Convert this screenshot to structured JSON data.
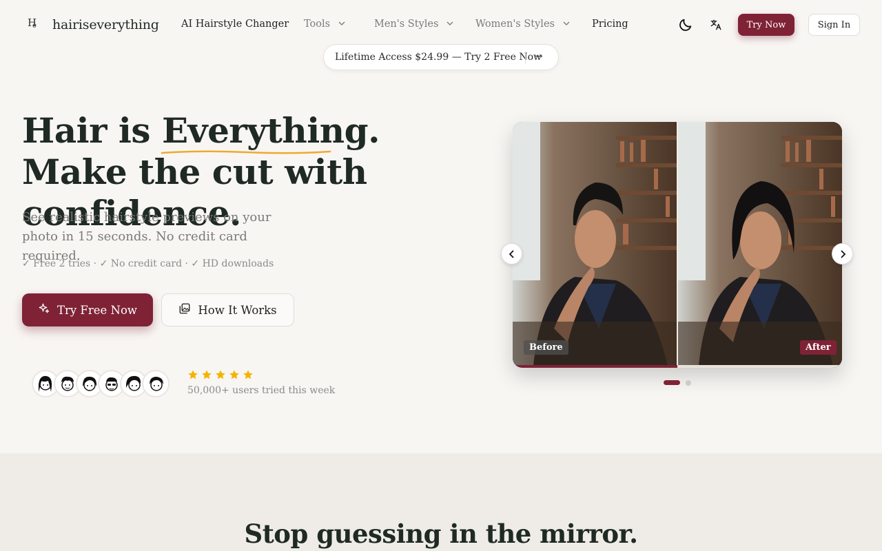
{
  "nav": {
    "brand": "hairiseverything",
    "logo_mark_h": "H",
    "logo_mark_e": "e",
    "items": [
      {
        "label": "AI Hairstyle Changer",
        "has_dropdown": false
      },
      {
        "label": "Tools",
        "has_dropdown": true
      },
      {
        "label": "Men's Styles",
        "has_dropdown": true
      },
      {
        "label": "Women's Styles",
        "has_dropdown": true
      },
      {
        "label": "Pricing",
        "has_dropdown": false
      }
    ],
    "icons": [
      "moon-icon",
      "translate-icon"
    ],
    "try_now_label": "Try Now",
    "sign_in_label": "Sign In"
  },
  "promo": {
    "text": "Lifetime Access $24.99 — Try 2 Free Now",
    "arrow": "→"
  },
  "hero": {
    "title_pre": "Hair is ",
    "title_highlight": "Everything",
    "title_post": ". Make the cut with confidence.",
    "subtitle": "See realistic hairstyle previews on your photo in 15 seconds. No credit card required.",
    "checks": "✓ Free 2 tries · ✓ No credit card · ✓ HD downloads",
    "primary_button": "Try Free Now",
    "secondary_button": "How It Works",
    "rating_stars": 5,
    "users_text": "50,000+ users tried this week",
    "avatar_count": 6
  },
  "carousel": {
    "before_label": "Before",
    "after_label": "After",
    "slide_index": 1,
    "slide_count": 2,
    "progress": 0.5
  },
  "section2": {
    "title": "Stop guessing in the mirror."
  },
  "colors": {
    "accent": "#7f2236",
    "background": "#f8f6f3",
    "star": "#f5b301",
    "highlight_underline": "#f0a830",
    "heading": "#1f2a24"
  }
}
